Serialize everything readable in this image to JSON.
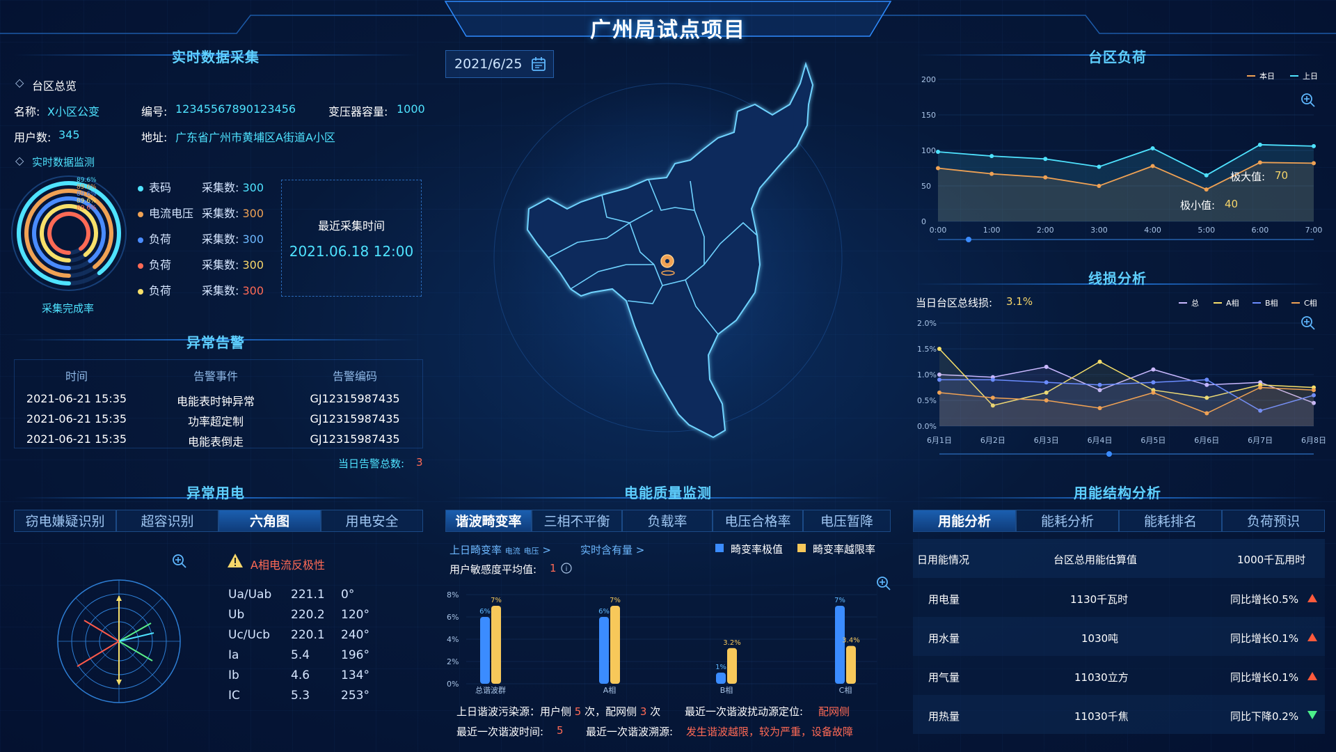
{
  "header": {
    "title": "广州局试点项目",
    "date": "2021/6/25"
  },
  "realtime": {
    "section_title": "实时数据采集",
    "overview_label": "台区总览",
    "name_label": "名称:",
    "name_value": "X小区公变",
    "code_label": "编号:",
    "code_value": "12345567890123456",
    "capacity_label": "变压器容量:",
    "capacity_value": "1000",
    "users_label": "用户数:",
    "users_value": "345",
    "address_label": "地址:",
    "address_value": "广东省广州市黄埔区A街道A小区",
    "monitor_label": "实时数据监测",
    "ring_percents": [
      "89.6%",
      "89.6%",
      "89.6%",
      "89.6%",
      "89.6%"
    ],
    "ring_caption": "采集完成率",
    "legend": [
      {
        "name": "表码",
        "count_label": "采集数:",
        "count": "300",
        "color": "#4fe3ff"
      },
      {
        "name": "电流电压",
        "count_label": "采集数:",
        "count": "300",
        "color": "#f0a254"
      },
      {
        "name": "负荷",
        "count_label": "采集数:",
        "count": "300",
        "color": "#4a8cff"
      },
      {
        "name": "负荷",
        "count_label": "采集数:",
        "count": "300",
        "color": "#ff6a55"
      },
      {
        "name": "负荷",
        "count_label": "采集数:",
        "count": "300",
        "color": "#f7e06a"
      }
    ],
    "last_time_label": "最近采集时间",
    "last_time_value": "2021.06.18 12:00"
  },
  "alarm": {
    "section_title": "异常告警",
    "headers": [
      "时间",
      "告警事件",
      "告警编码"
    ],
    "rows": [
      [
        "2021-06-21 15:35",
        "电能表时钟异常",
        "GJ12315987435"
      ],
      [
        "2021-06-21 15:35",
        "功率超定制",
        "GJ12315987435"
      ],
      [
        "2021-06-21 15:35",
        "电能表倒走",
        "GJ12315987435"
      ]
    ],
    "total_label": "当日告警总数:",
    "total_value": "3"
  },
  "abnormal": {
    "section_title": "异常用电",
    "tabs": [
      "窃电嫌疑识别",
      "超容识别",
      "六角图",
      "用电安全"
    ],
    "active_tab": 2,
    "warning": "A相电流反极性",
    "rows": [
      [
        "Ua/Uab",
        "221.1",
        "0°"
      ],
      [
        "Ub",
        "220.2",
        "120°"
      ],
      [
        "Uc/Ucb",
        "220.1",
        "240°"
      ],
      [
        "Ia",
        "5.4",
        "196°"
      ],
      [
        "Ib",
        "4.6",
        "134°"
      ],
      [
        "IC",
        "5.3",
        "253°"
      ]
    ]
  },
  "load": {
    "section_title": "台区负荷",
    "legend": [
      "本日",
      "上日"
    ],
    "colors": {
      "today": "#f0a254",
      "yesterday": "#4fe3ff"
    },
    "max_label": "极大值:",
    "max_value": "70",
    "min_label": "极小值:",
    "min_value": "40"
  },
  "loss": {
    "section_title": "线损分析",
    "total_label": "当日台区总线损:",
    "total_value": "3.1%",
    "legend": [
      "总",
      "A相",
      "B相",
      "C相"
    ]
  },
  "quality": {
    "section_title": "电能质量监测",
    "tabs": [
      "谐波畸变率",
      "三相不平衡",
      "负载率",
      "电压合格率",
      "电压暂降"
    ],
    "active_tab": 0,
    "sub_link1": "上日畸变率",
    "sub_small1": "电流",
    "sub_small2": "电压",
    "sub_link2": "实时含有量",
    "legend": [
      "畸变率极值",
      "畸变率越限率"
    ],
    "sensitivity_label": "用户敏感度平均值:",
    "sensitivity_value": "1",
    "pollution_label": "上日谐波污染源：用户侧",
    "pollution_user": "5",
    "pollution_mid": "次，配网侧",
    "pollution_grid": "3",
    "pollution_end": "次",
    "locate_label": "最近一次谐波扰动源定位:",
    "locate_value": "配网侧",
    "last_time_label": "最近一次谐波时间:",
    "last_time_value": "5",
    "trace_label": "最近一次谐波溯源:",
    "trace_value": "发生谐波越限，较为严重，设备故障"
  },
  "structure": {
    "section_title": "用能结构分析",
    "tabs": [
      "用能分析",
      "能耗分析",
      "能耗排名",
      "负荷预识"
    ],
    "active_tab": 0,
    "header": [
      "日用能情况",
      "台区总用能估算值",
      "1000千瓦用时"
    ],
    "rows": [
      {
        "name": "用电量",
        "value": "1130千瓦时",
        "trend": "同比增长0.5%",
        "dir": "up"
      },
      {
        "name": "用水量",
        "value": "1030吨",
        "trend": "同比增长0.1%",
        "dir": "up"
      },
      {
        "name": "用气量",
        "value": "11030立方",
        "trend": "同比增长0.1%",
        "dir": "up"
      },
      {
        "name": "用热量",
        "value": "11030千焦",
        "trend": "同比下降0.2%",
        "dir": "down"
      }
    ]
  },
  "chart_data": [
    {
      "type": "line",
      "title": "台区负荷",
      "x": [
        "0:00",
        "1:00",
        "2:00",
        "3:00",
        "4:00",
        "5:00",
        "6:00",
        "7:00"
      ],
      "ylim": [
        0,
        200
      ],
      "yticks": [
        0,
        50,
        100,
        150,
        200
      ],
      "series": [
        {
          "name": "本日",
          "values": [
            75,
            67,
            62,
            50,
            78,
            45,
            83,
            82
          ]
        },
        {
          "name": "上日",
          "values": [
            98,
            92,
            88,
            77,
            103,
            65,
            108,
            106
          ]
        }
      ]
    },
    {
      "type": "line",
      "title": "线损分析",
      "x": [
        "6月1日",
        "6月2日",
        "6月3日",
        "6月4日",
        "6月5日",
        "6月6日",
        "6月7日",
        "6月8日"
      ],
      "ylim": [
        0,
        2.0
      ],
      "ytick_labels": [
        "0.0%",
        "0.5%",
        "1.0%",
        "1.5%",
        "2.0%"
      ],
      "yticks": [
        0,
        0.5,
        1.0,
        1.5,
        2.0
      ],
      "series": [
        {
          "name": "总",
          "values": [
            1.0,
            0.95,
            1.15,
            0.7,
            1.1,
            0.8,
            0.85,
            0.45
          ]
        },
        {
          "name": "A相",
          "values": [
            1.5,
            0.4,
            0.65,
            1.25,
            0.7,
            0.55,
            0.8,
            0.75
          ]
        },
        {
          "name": "B相",
          "values": [
            0.9,
            0.9,
            0.85,
            0.8,
            0.85,
            0.9,
            0.3,
            0.6
          ]
        },
        {
          "name": "C相",
          "values": [
            0.65,
            0.55,
            0.5,
            0.35,
            0.65,
            0.25,
            0.75,
            0.7
          ]
        }
      ]
    },
    {
      "type": "bar",
      "title": "谐波畸变率",
      "categories": [
        "总谐波群",
        "A相",
        "B相",
        "C相"
      ],
      "ylim": [
        0,
        8
      ],
      "ytick_labels": [
        "0%",
        "2%",
        "4%",
        "6%",
        "8%"
      ],
      "yticks": [
        0,
        2,
        4,
        6,
        8
      ],
      "series": [
        {
          "name": "畸变率极值",
          "values": [
            6,
            6,
            1,
            7
          ],
          "labels": [
            "6%",
            "6%",
            "1%",
            "7%"
          ]
        },
        {
          "name": "畸变率越限率",
          "values": [
            7,
            7,
            3.2,
            3.4
          ],
          "labels": [
            "7%",
            "7%",
            "3.2%",
            "3.4%"
          ]
        }
      ]
    }
  ]
}
